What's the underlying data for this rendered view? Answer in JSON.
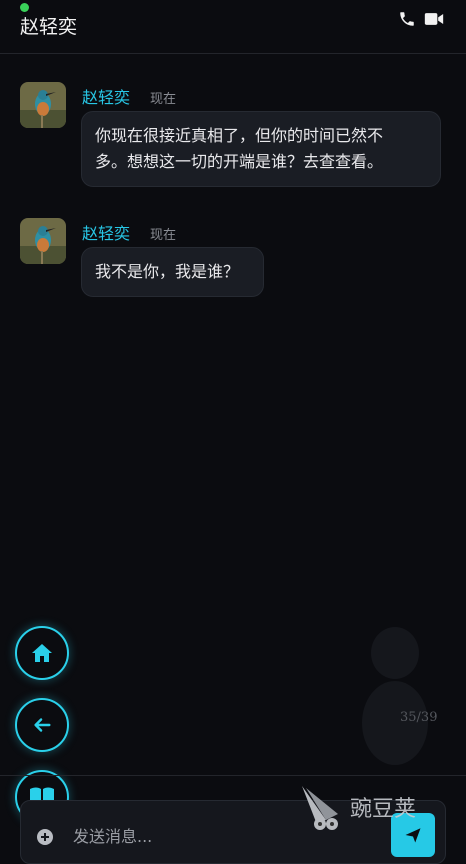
{
  "header": {
    "title": "赵轻奕",
    "icons": [
      "phone-icon",
      "video-icon"
    ]
  },
  "messages": [
    {
      "sender": "赵轻奕",
      "time": "现在",
      "text_line1": "你现在很接近真相了，但你的时间已然不",
      "text_line2": "多。想想这一切的开端是谁？去查查看。"
    },
    {
      "sender": "赵轻奕",
      "time": "现在",
      "text_line1": "我不是你，我是谁？"
    }
  ],
  "navigation": {
    "icons": [
      "home-icon",
      "back-arrow-icon",
      "book-icon"
    ]
  },
  "page_counter": "35/39",
  "composer": {
    "placeholder": "发送消息...",
    "plus_icon": "plus-circle-icon",
    "send_icon": "send-icon"
  },
  "watermark": {
    "text": "豌豆荚"
  },
  "colors": {
    "accent": "#26c9e6",
    "online": "#3ad15a",
    "background": "#0b0c10",
    "bubble": "#1a1d24"
  }
}
